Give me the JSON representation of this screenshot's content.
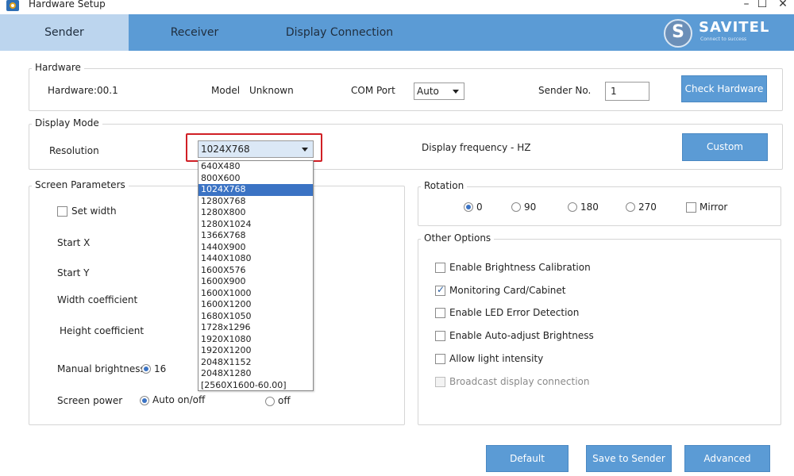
{
  "window": {
    "title": "Hardware Setup",
    "controls": [
      "–",
      "☐",
      "✕"
    ]
  },
  "tabs": [
    "Sender",
    "Receiver",
    "Display Connection"
  ],
  "logo": {
    "name": "SAVITEL",
    "tagline": "Connect to success",
    "badge_letter": "S"
  },
  "hardware": {
    "group_title": "Hardware",
    "hardware_label": "Hardware:00.1",
    "model_label": "Model",
    "model_value": "Unknown",
    "com_port_label": "COM Port",
    "com_port_value": "Auto",
    "sender_no_label": "Sender No.",
    "sender_no_value": "1",
    "check_button": "Check Hardware"
  },
  "display_mode": {
    "group_title": "Display Mode",
    "resolution_label": "Resolution",
    "resolution_value": "1024X768",
    "frequency_label": "Display frequency - HZ",
    "custom_button": "Custom",
    "options": [
      "640X480",
      "800X600",
      "1024X768",
      "1280X768",
      "1280X800",
      "1280X1024",
      "1366X768",
      "1440X900",
      "1440X1080",
      "1600X576",
      "1600X900",
      "1600X1000",
      "1600X1200",
      "1680X1050",
      "1728x1296",
      "1920X1080",
      "1920X1200",
      "2048X1152",
      "2048X1280",
      "[2560X1600-60.00]"
    ]
  },
  "screen_parameters": {
    "group_title": "Screen Parameters",
    "set_width_label": "Set width",
    "start_x_label": "Start X",
    "start_y_label": "Start Y",
    "width_coefficient_label": "Width coefficient",
    "height_coefficient_label": "Height coefficient",
    "manual_brightness_label": "Manual brightness:",
    "manual_brightness_value": "16",
    "screen_power_label": "Screen power",
    "power_auto_label": "Auto on/off",
    "power_off_label": "off"
  },
  "rotation": {
    "group_title": "Rotation",
    "options": [
      "0",
      "90",
      "180",
      "270"
    ],
    "selected": "0",
    "mirror_label": "Mirror"
  },
  "other_options": {
    "group_title": "Other Options",
    "items": [
      {
        "label": "Enable Brightness Calibration",
        "checked": false,
        "enabled": true
      },
      {
        "label": "Monitoring Card/Cabinet",
        "checked": true,
        "enabled": true
      },
      {
        "label": "Enable LED Error Detection",
        "checked": false,
        "enabled": true
      },
      {
        "label": "Enable Auto-adjust Brightness",
        "checked": false,
        "enabled": true
      },
      {
        "label": "Allow light intensity",
        "checked": false,
        "enabled": true
      },
      {
        "label": "Broadcast display connection",
        "checked": false,
        "enabled": false
      }
    ]
  },
  "footer": {
    "default_button": "Default",
    "save_button": "Save to Sender",
    "advanced_button": "Advanced"
  },
  "colors": {
    "tab_bar": "#5b9bd5",
    "tab_active": "#bcd5ee",
    "button": "#5b9bd5",
    "highlight": "#d01f25",
    "selection": "#3b73c4"
  }
}
